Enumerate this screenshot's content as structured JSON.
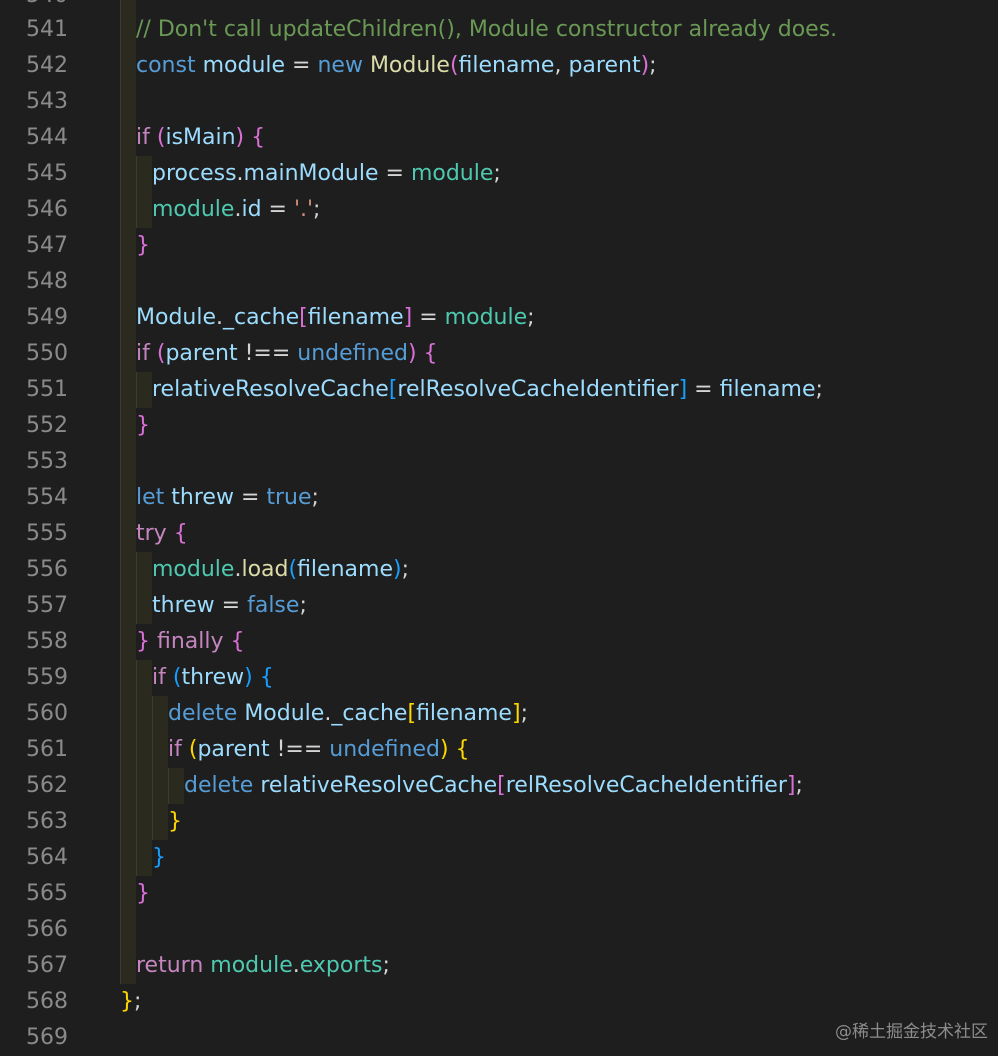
{
  "editor": {
    "partial_top_line_number": "540",
    "lines": [
      {
        "n": "541",
        "indent": 1,
        "tokens": [
          {
            "t": "// Don't call updateChildren(), Module constructor already does.",
            "c": "comment"
          }
        ]
      },
      {
        "n": "542",
        "indent": 1,
        "tokens": [
          {
            "t": "const",
            "c": "keyword"
          },
          {
            "t": " ",
            "c": "op"
          },
          {
            "t": "module",
            "c": "var"
          },
          {
            "t": " = ",
            "c": "op"
          },
          {
            "t": "new",
            "c": "keyword"
          },
          {
            "t": " ",
            "c": "op"
          },
          {
            "t": "Module",
            "c": "func"
          },
          {
            "t": "(",
            "c": "b2"
          },
          {
            "t": "filename",
            "c": "var"
          },
          {
            "t": ", ",
            "c": "op"
          },
          {
            "t": "parent",
            "c": "var"
          },
          {
            "t": ")",
            "c": "b2"
          },
          {
            "t": ";",
            "c": "op"
          }
        ]
      },
      {
        "n": "543",
        "indent": 1,
        "tokens": []
      },
      {
        "n": "544",
        "indent": 1,
        "tokens": [
          {
            "t": "if",
            "c": "control"
          },
          {
            "t": " ",
            "c": "op"
          },
          {
            "t": "(",
            "c": "b2"
          },
          {
            "t": "isMain",
            "c": "var"
          },
          {
            "t": ")",
            "c": "b2"
          },
          {
            "t": " ",
            "c": "op"
          },
          {
            "t": "{",
            "c": "b2"
          }
        ]
      },
      {
        "n": "545",
        "indent": 2,
        "tokens": [
          {
            "t": "process",
            "c": "var"
          },
          {
            "t": ".",
            "c": "op"
          },
          {
            "t": "mainModule",
            "c": "var"
          },
          {
            "t": " = ",
            "c": "op"
          },
          {
            "t": "module",
            "c": "type"
          },
          {
            "t": ";",
            "c": "op"
          }
        ]
      },
      {
        "n": "546",
        "indent": 2,
        "tokens": [
          {
            "t": "module",
            "c": "type"
          },
          {
            "t": ".",
            "c": "op"
          },
          {
            "t": "id",
            "c": "var"
          },
          {
            "t": " = ",
            "c": "op"
          },
          {
            "t": "'.'",
            "c": "string"
          },
          {
            "t": ";",
            "c": "op"
          }
        ]
      },
      {
        "n": "547",
        "indent": 1,
        "tokens": [
          {
            "t": "}",
            "c": "b2"
          }
        ]
      },
      {
        "n": "548",
        "indent": 1,
        "tokens": []
      },
      {
        "n": "549",
        "indent": 1,
        "tokens": [
          {
            "t": "Module",
            "c": "var"
          },
          {
            "t": ".",
            "c": "op"
          },
          {
            "t": "_cache",
            "c": "var"
          },
          {
            "t": "[",
            "c": "b2"
          },
          {
            "t": "filename",
            "c": "var"
          },
          {
            "t": "]",
            "c": "b2"
          },
          {
            "t": " = ",
            "c": "op"
          },
          {
            "t": "module",
            "c": "type"
          },
          {
            "t": ";",
            "c": "op"
          }
        ]
      },
      {
        "n": "550",
        "indent": 1,
        "tokens": [
          {
            "t": "if",
            "c": "control"
          },
          {
            "t": " ",
            "c": "op"
          },
          {
            "t": "(",
            "c": "b2"
          },
          {
            "t": "parent",
            "c": "var"
          },
          {
            "t": " !== ",
            "c": "op"
          },
          {
            "t": "undefined",
            "c": "keyword"
          },
          {
            "t": ")",
            "c": "b2"
          },
          {
            "t": " ",
            "c": "op"
          },
          {
            "t": "{",
            "c": "b2"
          }
        ]
      },
      {
        "n": "551",
        "indent": 2,
        "tokens": [
          {
            "t": "relativeResolveCache",
            "c": "var"
          },
          {
            "t": "[",
            "c": "b3"
          },
          {
            "t": "relResolveCacheIdentifier",
            "c": "var"
          },
          {
            "t": "]",
            "c": "b3"
          },
          {
            "t": " = ",
            "c": "op"
          },
          {
            "t": "filename",
            "c": "var"
          },
          {
            "t": ";",
            "c": "op"
          }
        ]
      },
      {
        "n": "552",
        "indent": 1,
        "tokens": [
          {
            "t": "}",
            "c": "b2"
          }
        ]
      },
      {
        "n": "553",
        "indent": 1,
        "tokens": []
      },
      {
        "n": "554",
        "indent": 1,
        "tokens": [
          {
            "t": "let",
            "c": "keyword"
          },
          {
            "t": " ",
            "c": "op"
          },
          {
            "t": "threw",
            "c": "var"
          },
          {
            "t": " = ",
            "c": "op"
          },
          {
            "t": "true",
            "c": "keyword"
          },
          {
            "t": ";",
            "c": "op"
          }
        ]
      },
      {
        "n": "555",
        "indent": 1,
        "tokens": [
          {
            "t": "try",
            "c": "control"
          },
          {
            "t": " ",
            "c": "op"
          },
          {
            "t": "{",
            "c": "b2"
          }
        ]
      },
      {
        "n": "556",
        "indent": 2,
        "tokens": [
          {
            "t": "module",
            "c": "type"
          },
          {
            "t": ".",
            "c": "op"
          },
          {
            "t": "load",
            "c": "func"
          },
          {
            "t": "(",
            "c": "b3"
          },
          {
            "t": "filename",
            "c": "var"
          },
          {
            "t": ")",
            "c": "b3"
          },
          {
            "t": ";",
            "c": "op"
          }
        ]
      },
      {
        "n": "557",
        "indent": 2,
        "tokens": [
          {
            "t": "threw",
            "c": "var"
          },
          {
            "t": " = ",
            "c": "op"
          },
          {
            "t": "false",
            "c": "keyword"
          },
          {
            "t": ";",
            "c": "op"
          }
        ]
      },
      {
        "n": "558",
        "indent": 1,
        "tokens": [
          {
            "t": "}",
            "c": "b2"
          },
          {
            "t": " ",
            "c": "op"
          },
          {
            "t": "finally",
            "c": "control"
          },
          {
            "t": " ",
            "c": "op"
          },
          {
            "t": "{",
            "c": "b2"
          }
        ]
      },
      {
        "n": "559",
        "indent": 2,
        "tokens": [
          {
            "t": "if",
            "c": "control"
          },
          {
            "t": " ",
            "c": "op"
          },
          {
            "t": "(",
            "c": "b3"
          },
          {
            "t": "threw",
            "c": "var"
          },
          {
            "t": ")",
            "c": "b3"
          },
          {
            "t": " ",
            "c": "op"
          },
          {
            "t": "{",
            "c": "b3"
          }
        ]
      },
      {
        "n": "560",
        "indent": 3,
        "tokens": [
          {
            "t": "delete",
            "c": "keyword"
          },
          {
            "t": " ",
            "c": "op"
          },
          {
            "t": "Module",
            "c": "var"
          },
          {
            "t": ".",
            "c": "op"
          },
          {
            "t": "_cache",
            "c": "var"
          },
          {
            "t": "[",
            "c": "b1"
          },
          {
            "t": "filename",
            "c": "var"
          },
          {
            "t": "]",
            "c": "b1"
          },
          {
            "t": ";",
            "c": "op"
          }
        ]
      },
      {
        "n": "561",
        "indent": 3,
        "tokens": [
          {
            "t": "if",
            "c": "control"
          },
          {
            "t": " ",
            "c": "op"
          },
          {
            "t": "(",
            "c": "b1"
          },
          {
            "t": "parent",
            "c": "var"
          },
          {
            "t": " !== ",
            "c": "op"
          },
          {
            "t": "undefined",
            "c": "keyword"
          },
          {
            "t": ")",
            "c": "b1"
          },
          {
            "t": " ",
            "c": "op"
          },
          {
            "t": "{",
            "c": "b1"
          }
        ]
      },
      {
        "n": "562",
        "indent": 4,
        "tokens": [
          {
            "t": "delete",
            "c": "keyword"
          },
          {
            "t": " ",
            "c": "op"
          },
          {
            "t": "relativeResolveCache",
            "c": "var"
          },
          {
            "t": "[",
            "c": "b2"
          },
          {
            "t": "relResolveCacheIdentifier",
            "c": "var"
          },
          {
            "t": "]",
            "c": "b2"
          },
          {
            "t": ";",
            "c": "op"
          }
        ]
      },
      {
        "n": "563",
        "indent": 3,
        "tokens": [
          {
            "t": "}",
            "c": "b1"
          }
        ]
      },
      {
        "n": "564",
        "indent": 2,
        "tokens": [
          {
            "t": "}",
            "c": "b3"
          }
        ]
      },
      {
        "n": "565",
        "indent": 1,
        "tokens": [
          {
            "t": "}",
            "c": "b2"
          }
        ]
      },
      {
        "n": "566",
        "indent": 1,
        "tokens": []
      },
      {
        "n": "567",
        "indent": 1,
        "tokens": [
          {
            "t": "return",
            "c": "control"
          },
          {
            "t": " ",
            "c": "op"
          },
          {
            "t": "module",
            "c": "type"
          },
          {
            "t": ".",
            "c": "op"
          },
          {
            "t": "exports",
            "c": "type"
          },
          {
            "t": ";",
            "c": "op"
          }
        ]
      },
      {
        "n": "568",
        "indent": 0,
        "tokens": [
          {
            "t": "}",
            "c": "b1"
          },
          {
            "t": ";",
            "c": "op"
          }
        ]
      },
      {
        "n": "569",
        "indent": 0,
        "tokens": []
      }
    ]
  },
  "watermark": {
    "text": "@稀土掘金技术社区"
  },
  "colors": {
    "background": "#1e1e1e",
    "line_number": "#8a8a8a",
    "comment": "#6a9955",
    "keyword": "#569cd6",
    "control": "#c586c0",
    "variable": "#9cdcfe",
    "type": "#4ec9b0",
    "function": "#dcdcaa",
    "string": "#ce9178",
    "bracket_1": "#ffd700",
    "bracket_2": "#da70d6",
    "bracket_3": "#179fff"
  }
}
